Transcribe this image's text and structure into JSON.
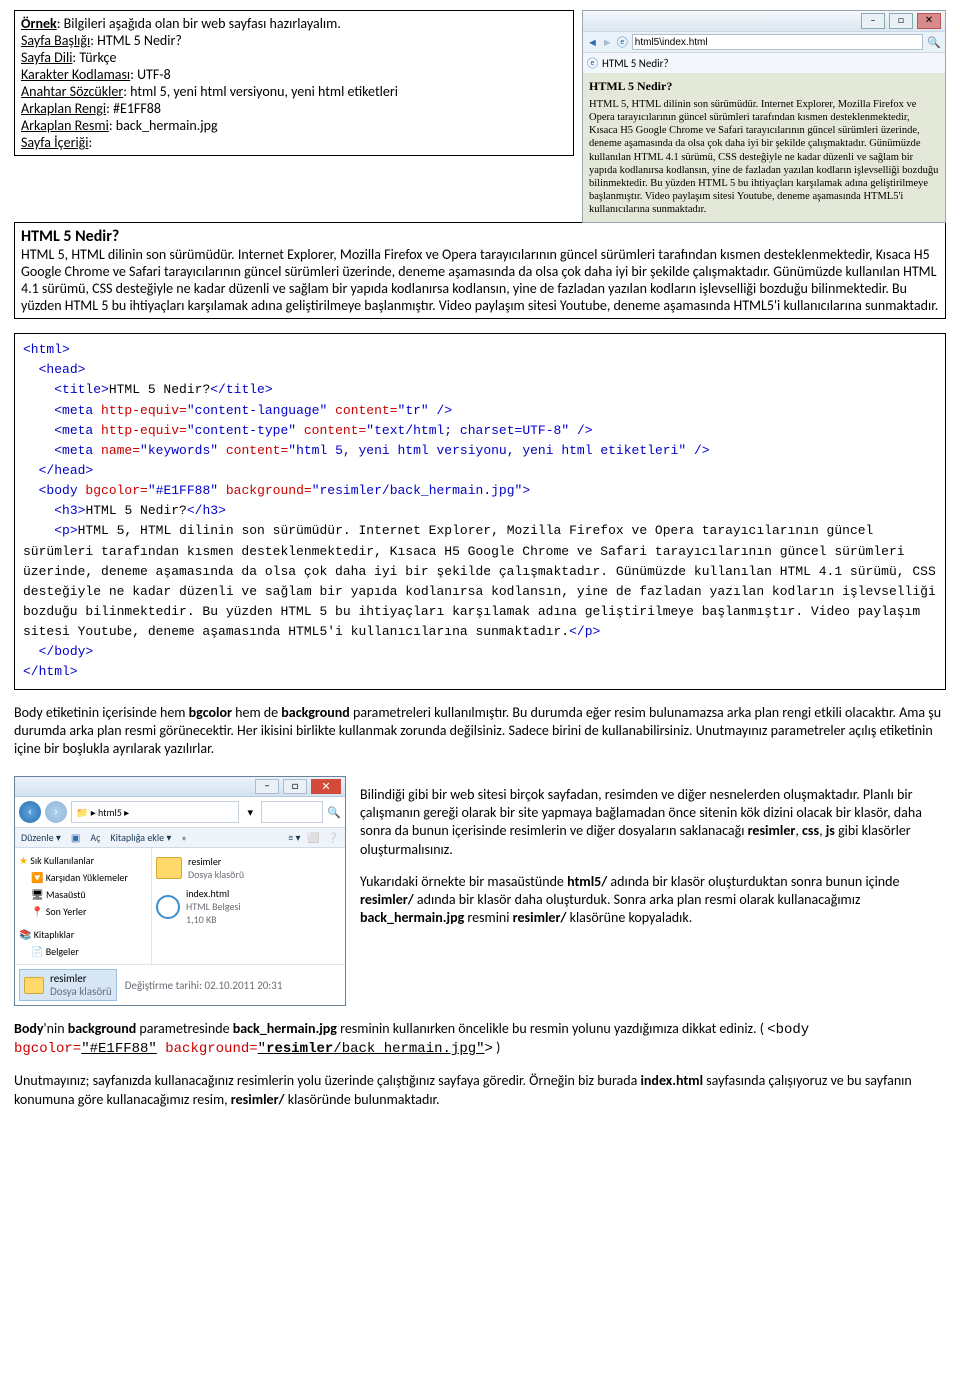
{
  "intro": {
    "ornek_label": "Örnek",
    "ornek_text": ": Bilgileri aşağıda olan bir web sayfası hazırlayalım.",
    "baslik_label": "Sayfa Başlığı",
    "baslik_value": ": HTML 5 Nedir?",
    "dil_label": "Sayfa Dili",
    "dil_value": ": Türkçe",
    "charset_label": "Karakter Kodlaması",
    "charset_value": ": UTF-8",
    "keywords_label": "Anahtar Sözcükler",
    "keywords_value": ": html 5, yeni html versiyonu, yeni html etiketleri",
    "bgcolor_label": "Arkaplan Rengi",
    "bgcolor_value": ": #E1FF88",
    "bgimg_label": "Arkaplan Resmi",
    "bgimg_value": ": back_hermain.jpg",
    "icerik_label": "Sayfa İçeriği",
    "icerik_colon": ":"
  },
  "content": {
    "heading": "HTML 5 Nedir?",
    "body": "HTML 5, HTML dilinin son sürümüdür. Internet Explorer, Mozilla Firefox ve Opera tarayıcılarının güncel sürümleri tarafından kısmen desteklenmektedir, Kısaca H5 Google Chrome ve Safari tarayıcılarının güncel sürümleri üzerinde, deneme aşamasında da olsa çok daha iyi bir şekilde çalışmaktadır. Günümüzde kullanılan HTML 4.1 sürümü, CSS desteğiyle ne kadar düzenli ve sağlam bir yapıda kodlanırsa kodlansın, yine de fazladan yazılan kodların işlevselliği bozduğu bilinmektedir. Bu yüzden HTML 5 bu ihtiyaçları karşılamak adına geliştirilmeye başlanmıştır. Video paylaşım sitesi Youtube, deneme aşamasında HTML5'i kullanıcılarına sunmaktadır."
  },
  "browser": {
    "address": "html5\\index.html",
    "tab": "HTML 5 Nedir?",
    "heading": "HTML 5 Nedir?",
    "body": "HTML 5, HTML dilinin son sürümüdür. Internet Explorer, Mozilla Firefox ve Opera tarayıcılarının güncel sürümleri tarafından kısmen desteklenmektedir, Kısaca H5 Google Chrome ve Safari tarayıcılarının güncel sürümleri üzerinde, deneme aşamasında da olsa çok daha iyi bir şekilde çalışmaktadır. Günümüzde kullanılan HTML 4.1 sürümü, CSS desteğiyle ne kadar düzenli ve sağlam bir yapıda kodlanırsa kodlansın, yine de fazladan yazılan kodların işlevselliği bozduğu bilinmektedir. Bu yüzden HTML 5 bu ihtiyaçları karşılamak adına geliştirilmeye başlanmıştır. Video paylaşım sitesi Youtube, deneme aşamasında HTML5'i kullanıcılarına sunmaktadır."
  },
  "code": {
    "l1": "<html>",
    "l2": "  <head>",
    "l3a": "    <title>",
    "l3b": "HTML 5 Nedir?",
    "l3c": "</title>",
    "l4a": "    <meta ",
    "l4b": "http-equiv=",
    "l4c": "\"content-language\"",
    "l4d": " content=",
    "l4e": "\"tr\"",
    "l4f": " />",
    "l5a": "    <meta ",
    "l5b": "http-equiv=",
    "l5c": "\"content-type\"",
    "l5d": " content=",
    "l5e": "\"text/html; charset=UTF-8\"",
    "l5f": " />",
    "l6a": "    <meta ",
    "l6b": "name=",
    "l6c": "\"keywords\"",
    "l6d": " content=",
    "l6e": "\"html 5, yeni html versiyonu, yeni html etiketleri\"",
    "l6f": " />",
    "l7": "  </head>",
    "l8a": "  <body ",
    "l8b": "bgcolor=",
    "l8c": "\"#E1FF88\"",
    "l8d": " background=",
    "l8e": "\"resimler/back_hermain.jpg\"",
    "l8f": ">",
    "l9a": "    <h3>",
    "l9b": "HTML 5 Nedir?",
    "l9c": "</h3>",
    "l10a": "    <p>",
    "l10b": "HTML 5, HTML dilinin son sürümüdür. Internet Explorer, Mozilla Firefox ve Opera tarayıcılarının güncel sürümleri tarafından kısmen desteklenmektedir, Kısaca H5 Google Chrome ve Safari tarayıcılarının güncel sürümleri üzerinde, deneme aşamasında da olsa çok daha iyi bir şekilde çalışmaktadır. Günümüzde kullanılan HTML 4.1 sürümü, CSS desteğiyle ne kadar düzenli ve sağlam bir yapıda kodlanırsa kodlansın, yine de fazladan yazılan kodların işlevselliği bozduğu bilinmektedir. Bu yüzden HTML 5 bu ihtiyaçları karşılamak adına geliştirilmeye başlanmıştır. Video paylaşım sitesi Youtube, deneme aşamasında HTML5'i kullanıcılarına sunmaktadır.",
    "l10c": "</p>",
    "l11": "  </body>",
    "l12": "</html>"
  },
  "para1": {
    "t1": "Body etiketinin içerisinde hem ",
    "b1": "bgcolor",
    "t2": " hem de ",
    "b2": "background",
    "t3": " parametreleri kullanılmıştır. Bu durumda eğer resim bulunamazsa arka plan rengi etkili olacaktır. Ama şu durumda arka plan resmi görünecektir. Her ikisini birlikte kullanmak zorunda değilsiniz. Sadece birini de kullanabilirsiniz. Unutmayınız parametreler açılış etiketinin içine bir boşlukla ayrılarak yazılırlar."
  },
  "explorer": {
    "breadcrumb": "▸ html5 ▸",
    "toolbar": {
      "duzenle": "Düzenle ▾",
      "ac": "Aç",
      "kitap": "Kitaplığa ekle ▾",
      "chev": "»"
    },
    "tree": {
      "fav": "Sık Kullanılanlar",
      "indir": "Karşıdan Yüklemeler",
      "masa": "Masaüstü",
      "son": "Son Yerler",
      "kitap": "Kitaplıklar",
      "belge": "Belgeler"
    },
    "items": {
      "resimler": "resimler",
      "resimler_sub": "Dosya klasörü",
      "index": "index.html",
      "index_sub1": "HTML Belgesi",
      "index_sub2": "1,10 KB"
    },
    "selected": "resimler",
    "selected_sub": "Dosya klasörü",
    "status": "Değiştirme tarihi: 02.10.2011 20:31"
  },
  "para2": {
    "p1a": "Bilindiği gibi bir web sitesi birçok sayfadan, resimden ve diğer nesnelerden oluşmaktadır. Planlı bir çalışmanın gereği olarak bir site yapmaya bağlamadan önce sitenin kök dizini olacak bir klasör, daha sonra da bunun içerisinde resimlerin ve diğer dosyaların saklanacağı ",
    "b1": "resimler",
    "p1b": ", ",
    "b2": "css",
    "p1c": ", ",
    "b3": "js",
    "p1d": " gibi klasörler oluşturmalısınız.",
    "p2a": "Yukarıdaki örnekte bir masaüstünde ",
    "b4": "html5/",
    "p2b": " adında bir klasör oluşturduktan sonra bunun içinde ",
    "b5": "resimler/",
    "p2c": " adında bir klasör daha oluşturduk. Sonra arka plan resmi olarak kullanacağımız ",
    "b6": "back_hermain.jpg",
    "p2d": " resmini ",
    "b7": "resimler/",
    "p2e": " klasörüne kopyaladık."
  },
  "para3": {
    "t1": "Body",
    "t2": "'nin ",
    "b1": "background",
    "t3": " parametresinde ",
    "b2": "back_hermain.jpg",
    "t4": " resminin kullanırken öncelikle bu resmin yolunu yazdığımıza dikkat ediniz.  ( ",
    "code_open": "<body ",
    "code_bg": "bgcolor=",
    "code_bgv": "\"#E1FF88\"",
    "code_back": " background=",
    "code_backv1": "\"",
    "code_backv2": "resimler",
    "code_backv3": "/back_hermain.jpg\"",
    "code_close": ">",
    "t5": " )"
  },
  "para4": {
    "t1": "Unutmayınız; sayfanızda kullanacağınız resimlerin yolu üzerinde çalıştığınız sayfaya göredir. Örneğin biz burada ",
    "b1": "index.html",
    "t2": " sayfasında çalışıyoruz ve bu sayfanın konumuna göre kullanacağımız resim, ",
    "b2": "resimler/",
    "t3": " klasöründe bulunmaktadır."
  }
}
